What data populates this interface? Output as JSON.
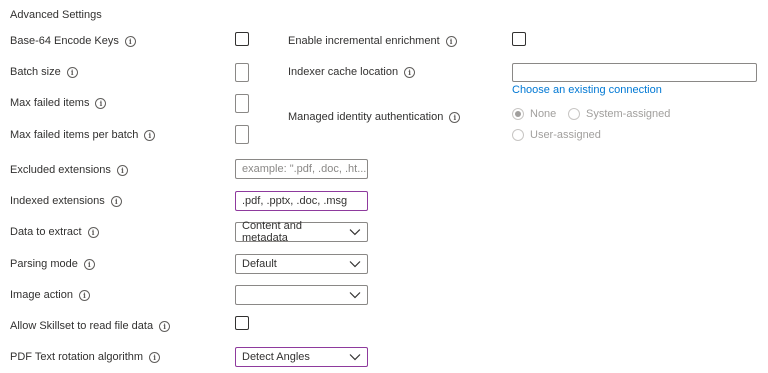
{
  "section_title": "Advanced Settings",
  "info_glyph": "i",
  "left_fields": {
    "base64_label": "Base-64 Encode Keys",
    "batch_size_label": "Batch size",
    "max_failed_label": "Max failed items",
    "max_failed_batch_label": "Max failed items per batch",
    "excluded_ext_label": "Excluded extensions",
    "excluded_ext_placeholder": "example: \".pdf, .doc, .ht...",
    "indexed_ext_label": "Indexed extensions",
    "indexed_ext_value": ".pdf, .pptx, .doc, .msg",
    "data_to_extract_label": "Data to extract",
    "data_to_extract_value": "Content and metadata",
    "parsing_mode_label": "Parsing mode",
    "parsing_mode_value": "Default",
    "image_action_label": "Image action",
    "image_action_value": "",
    "allow_skillset_label": "Allow Skillset to read file data",
    "pdf_rotation_label": "PDF Text rotation algorithm",
    "pdf_rotation_value": "Detect Angles"
  },
  "right_fields": {
    "incremental_label": "Enable incremental enrichment",
    "cache_location_label": "Indexer cache location",
    "cache_location_value": "",
    "choose_connection_link": "Choose an existing connection",
    "managed_identity_label": "Managed identity authentication",
    "radio_none": "None",
    "radio_system": "System-assigned",
    "radio_user": "User-assigned",
    "selected_radio": "None"
  },
  "colors": {
    "accent_focus": "#8e3a9d",
    "link": "#0078d4",
    "disabled_text": "#a19f9d"
  },
  "icons": [
    "info-icon",
    "chevron-down-icon"
  ]
}
